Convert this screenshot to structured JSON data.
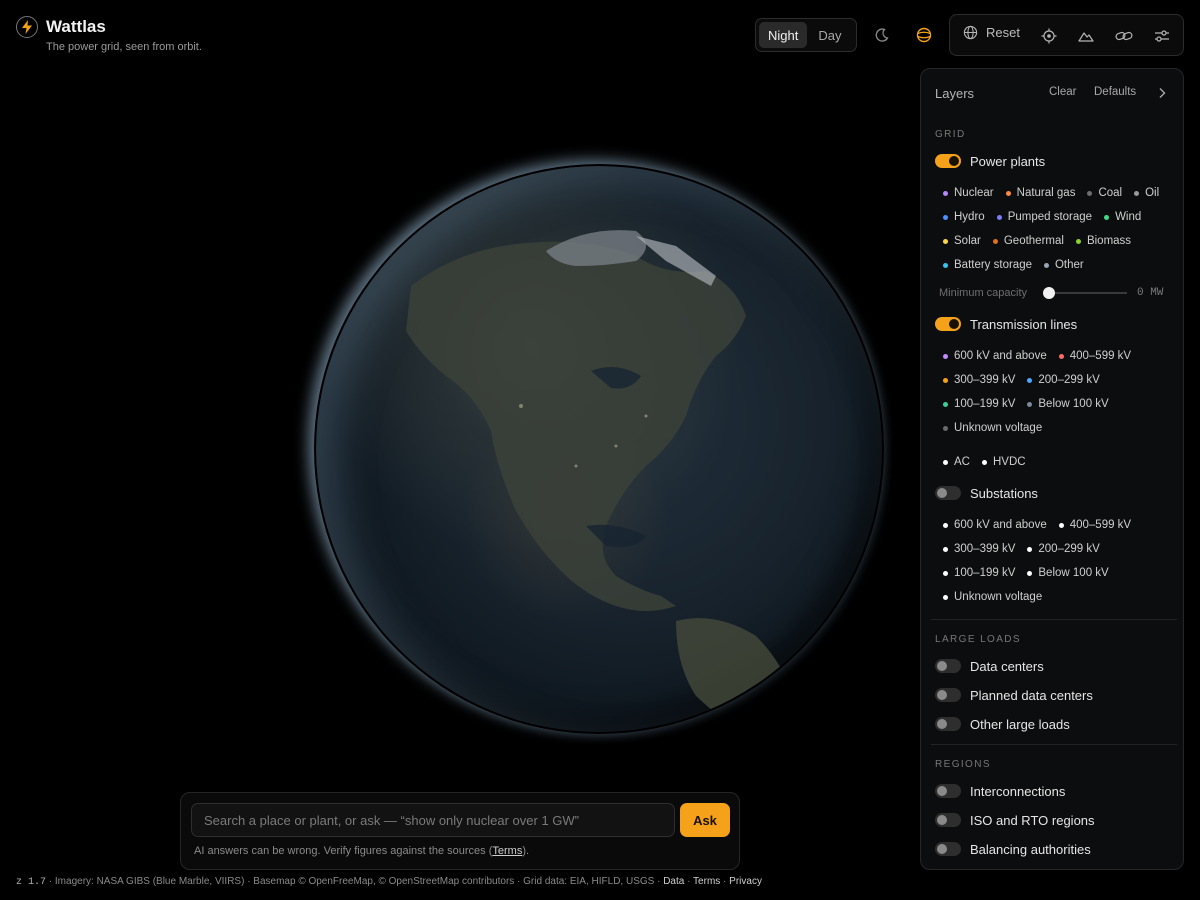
{
  "app": {
    "title": "Wattlas",
    "subtitle": "The power grid, seen from orbit."
  },
  "mode_toggle": {
    "night": "Night",
    "day": "Day",
    "active": "Night"
  },
  "toolbar": {
    "reset": "Reset"
  },
  "colors": {
    "accent": "#f5a11a"
  },
  "panel": {
    "title": "Layers",
    "clear": "Clear",
    "defaults": "Defaults",
    "grid": {
      "title": "GRID",
      "power_plants": {
        "label": "Power plants",
        "on": true,
        "legend": [
          {
            "label": "Nuclear",
            "color": "#b388ff"
          },
          {
            "label": "Natural gas",
            "color": "#ff8a3d"
          },
          {
            "label": "Coal",
            "color": "#6e6e6e"
          },
          {
            "label": "Oil",
            "color": "#9a9a9a"
          },
          {
            "label": "Hydro",
            "color": "#4a90ff"
          },
          {
            "label": "Pumped storage",
            "color": "#7b7dff"
          },
          {
            "label": "Wind",
            "color": "#3ddc84"
          },
          {
            "label": "Solar",
            "color": "#ffd54a"
          },
          {
            "label": "Geothermal",
            "color": "#e0701e"
          },
          {
            "label": "Biomass",
            "color": "#8bd12f"
          },
          {
            "label": "Battery storage",
            "color": "#33c3f0"
          },
          {
            "label": "Other",
            "color": "#9aa6b8"
          }
        ],
        "min_capacity": {
          "label": "Minimum capacity",
          "value": "0 MW"
        }
      },
      "transmission": {
        "label": "Transmission lines",
        "on": true,
        "legend": [
          {
            "label": "600 kV and above",
            "color": "#c38bff"
          },
          {
            "label": "400–599 kV",
            "color": "#ff6b6b"
          },
          {
            "label": "300–399 kV",
            "color": "#f5a11a"
          },
          {
            "label": "200–299 kV",
            "color": "#4aa8ff"
          },
          {
            "label": "100–199 kV",
            "color": "#3ccf9a"
          },
          {
            "label": "Below 100 kV",
            "color": "#7a8a99"
          },
          {
            "label": "Unknown voltage",
            "color": "#6a6a6a"
          }
        ],
        "types": [
          {
            "label": "AC",
            "color": "#ffffff"
          },
          {
            "label": "HVDC",
            "color": "#ffffff"
          }
        ]
      },
      "substations": {
        "label": "Substations",
        "on": false,
        "legend": [
          {
            "label": "600 kV and above",
            "color": "#ffffff"
          },
          {
            "label": "400–599 kV",
            "color": "#ffffff"
          },
          {
            "label": "300–399 kV",
            "color": "#ffffff"
          },
          {
            "label": "200–299 kV",
            "color": "#ffffff"
          },
          {
            "label": "100–199 kV",
            "color": "#ffffff"
          },
          {
            "label": "Below 100 kV",
            "color": "#ffffff"
          },
          {
            "label": "Unknown voltage",
            "color": "#ffffff"
          }
        ]
      }
    },
    "large_loads": {
      "title": "LARGE LOADS",
      "items": [
        {
          "label": "Data centers",
          "on": false
        },
        {
          "label": "Planned data centers",
          "on": false
        },
        {
          "label": "Other large loads",
          "on": false
        }
      ]
    },
    "regions": {
      "title": "REGIONS",
      "items": [
        {
          "label": "Interconnections",
          "on": false
        },
        {
          "label": "ISO and RTO regions",
          "on": false
        },
        {
          "label": "Balancing authorities",
          "on": false
        }
      ]
    }
  },
  "search": {
    "placeholder": "Search a place or plant, or ask — “show only nuclear over 1 GW”",
    "ask": "Ask",
    "disclaimer_pre": "AI answers can be wrong. Verify figures against the sources (",
    "disclaimer_link": "Terms",
    "disclaimer_post": ")."
  },
  "footer": {
    "zoom": "z 1.7",
    "attribution": " · Imagery: NASA GIBS (Blue Marble, VIIRS) · Basemap © OpenFreeMap, © OpenStreetMap contributors · Grid data: EIA, HIFLD, USGS · ",
    "data": "Data",
    "sep": " · ",
    "terms": "Terms",
    "privacy": "Privacy"
  }
}
